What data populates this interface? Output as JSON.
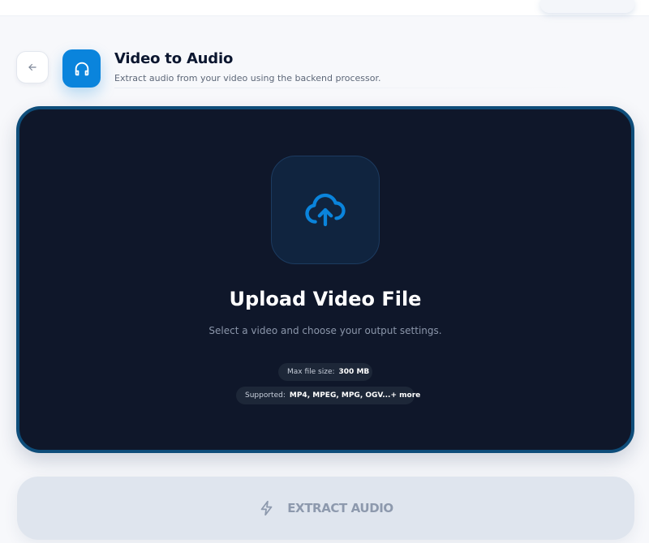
{
  "header": {
    "title": "Video to Audio",
    "subtitle": "Extract audio from your video using the backend processor.",
    "back_icon": "arrow-left-icon",
    "tool_icon": "headphones-icon"
  },
  "upload": {
    "icon": "cloud-upload-icon",
    "title": "Upload Video File",
    "description": "Select a video and choose your output settings.",
    "max_size_label": "Max file size:",
    "max_size_value": "300 MB",
    "supported_label": "Supported:",
    "supported_value": "MP4, MPEG, MPG, OGV...+ more"
  },
  "action": {
    "label": "EXTRACT AUDIO",
    "icon": "lightning-icon",
    "enabled": false
  },
  "colors": {
    "accent": "#0a84dc",
    "dropzone_bg": "#0f172a",
    "dropzone_border": "#0e4d7a",
    "button_disabled_bg": "#dfe5ee",
    "button_disabled_text": "#8d99ad"
  }
}
